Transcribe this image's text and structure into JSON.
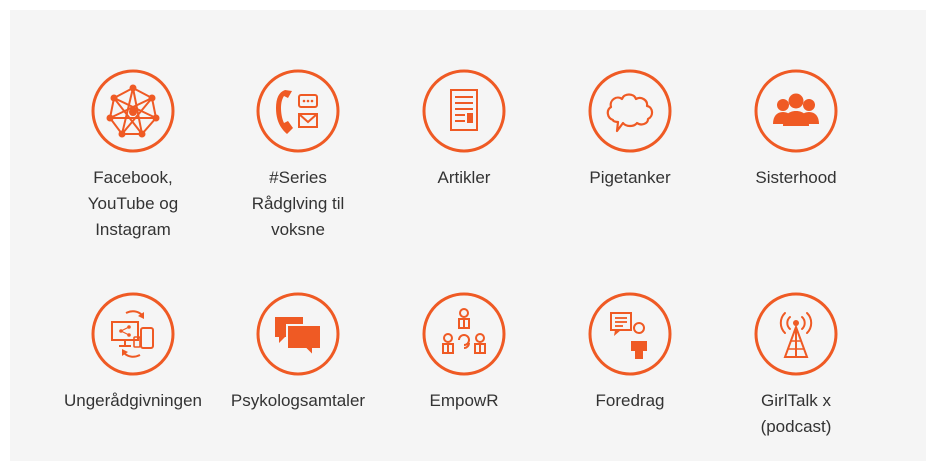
{
  "accent_color": "#ef5a24",
  "items": [
    {
      "label": "Facebook,\nYouTube og\nInstagram",
      "icon": "network-icon"
    },
    {
      "label": "#Series\nRådglving til\nvoksne",
      "icon": "phone-chat-icon"
    },
    {
      "label": "Artikler",
      "icon": "article-icon"
    },
    {
      "label": "Pigetanker",
      "icon": "thought-bubble-icon"
    },
    {
      "label": "Sisterhood",
      "icon": "group-icon"
    },
    {
      "label": "Ungerådgivningen",
      "icon": "devices-icon"
    },
    {
      "label": "Psykologsamtaler",
      "icon": "chat-bubbles-icon"
    },
    {
      "label": "EmpowR",
      "icon": "team-icon"
    },
    {
      "label": "Foredrag",
      "icon": "presenter-icon"
    },
    {
      "label": "GirlTalk x\n(podcast)",
      "icon": "broadcast-tower-icon"
    }
  ]
}
